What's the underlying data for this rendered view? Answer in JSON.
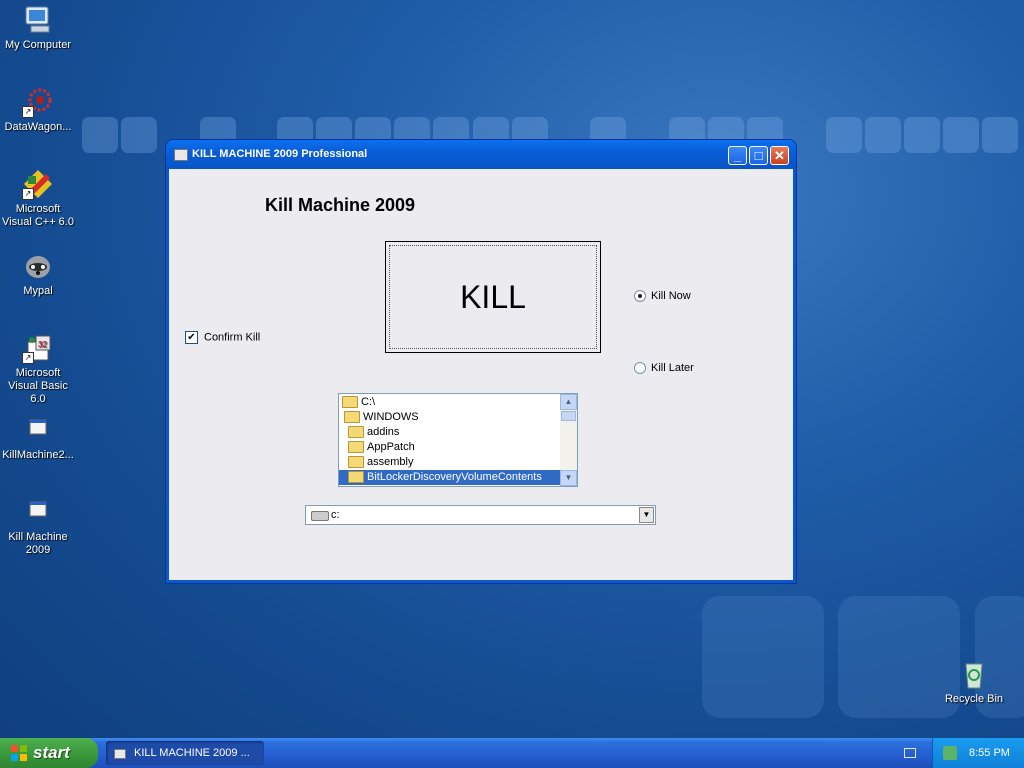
{
  "desktop": {
    "icons": [
      {
        "label": "My Computer"
      },
      {
        "label": "DataWagon..."
      },
      {
        "label": "Microsoft Visual C++ 6.0"
      },
      {
        "label": "Mypal"
      },
      {
        "label": "Microsoft Visual Basic 6.0"
      },
      {
        "label": "KillMachine2..."
      },
      {
        "label": "Kill Machine 2009"
      },
      {
        "label": "Recycle Bin"
      }
    ]
  },
  "window": {
    "title": "KILL MACHINE 2009 Professional",
    "min_glyph": "_",
    "max_glyph": "□",
    "close_glyph": "✕"
  },
  "form": {
    "heading": "Kill Machine 2009",
    "kill_button": "KILL",
    "confirm_checkbox": {
      "label": "Confirm Kill",
      "checked": true,
      "glyph": "✔"
    },
    "radio_kill_now": {
      "label": "Kill Now",
      "selected": true
    },
    "radio_kill_later": {
      "label": "Kill Later",
      "selected": false
    },
    "dir_list": {
      "items": [
        {
          "label": "C:\\"
        },
        {
          "label": "WINDOWS"
        },
        {
          "label": "addins"
        },
        {
          "label": "AppPatch"
        },
        {
          "label": "assembly"
        },
        {
          "label": "BitLockerDiscoveryVolumeContents",
          "selected": true
        }
      ],
      "scroll_up": "▲",
      "scroll_down": "▼"
    },
    "drive_combo": {
      "value": "c:",
      "arrow": "▼"
    }
  },
  "taskbar": {
    "start_label": "start",
    "task_item": "KILL MACHINE 2009 ...",
    "clock": "8:55 PM"
  },
  "colors": {
    "title_bar": "#0a5ed8",
    "selection": "#316ac5",
    "start_green": "#3c9a3c"
  }
}
